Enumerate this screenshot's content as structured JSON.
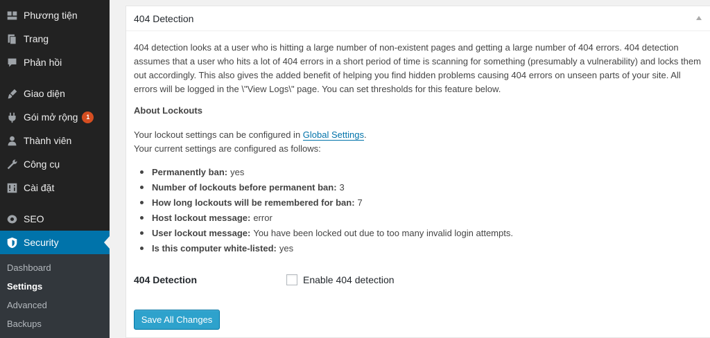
{
  "sidebar": {
    "items": [
      {
        "label": "Phương tiện",
        "icon": "media-icon"
      },
      {
        "label": "Trang",
        "icon": "pages-icon"
      },
      {
        "label": "Phản hồi",
        "icon": "comments-icon"
      },
      {
        "label": "Giao diện",
        "icon": "appearance-icon"
      },
      {
        "label": "Gói mở rộng",
        "icon": "plugins-icon",
        "badge": "1"
      },
      {
        "label": "Thành viên",
        "icon": "users-icon"
      },
      {
        "label": "Công cụ",
        "icon": "tools-icon"
      },
      {
        "label": "Cài đặt",
        "icon": "settings-icon"
      },
      {
        "label": "SEO",
        "icon": "seo-icon"
      },
      {
        "label": "Security",
        "icon": "shield-icon"
      }
    ],
    "submenu": [
      {
        "label": "Dashboard"
      },
      {
        "label": "Settings"
      },
      {
        "label": "Advanced"
      },
      {
        "label": "Backups"
      }
    ],
    "accent_color": "#0073aa"
  },
  "panel": {
    "title": "404 Detection",
    "intro": "404 detection looks at a user who is hitting a large number of non-existent pages and getting a large number of 404 errors. 404 detection assumes that a user who hits a lot of 404 errors in a short period of time is scanning for something (presumably a vulnerability) and locks them out accordingly. This also gives the added benefit of helping you find hidden problems causing 404 errors on unseen parts of your site. All errors will be logged in the \\\"View Logs\\\" page. You can set thresholds for this feature below.",
    "about_heading": "About Lockouts",
    "lockout_prefix": "Your lockout settings can be configured in ",
    "lockout_link": "Global Settings",
    "lockout_suffix": ".",
    "current_settings_intro": "Your current settings are configured as follows:",
    "settings": [
      {
        "key": "Permanently ban:",
        "value": "yes"
      },
      {
        "key": "Number of lockouts before permanent ban:",
        "value": "3"
      },
      {
        "key": "How long lockouts will be remembered for ban:",
        "value": "7"
      },
      {
        "key": "Host lockout message:",
        "value": "error"
      },
      {
        "key": "User lockout message:",
        "value": "You have been locked out due to too many invalid login attempts."
      },
      {
        "key": "Is this computer white-listed:",
        "value": "yes"
      }
    ],
    "field_label": "404 Detection",
    "checkbox_label": "Enable 404 detection",
    "save_label": "Save All Changes"
  }
}
